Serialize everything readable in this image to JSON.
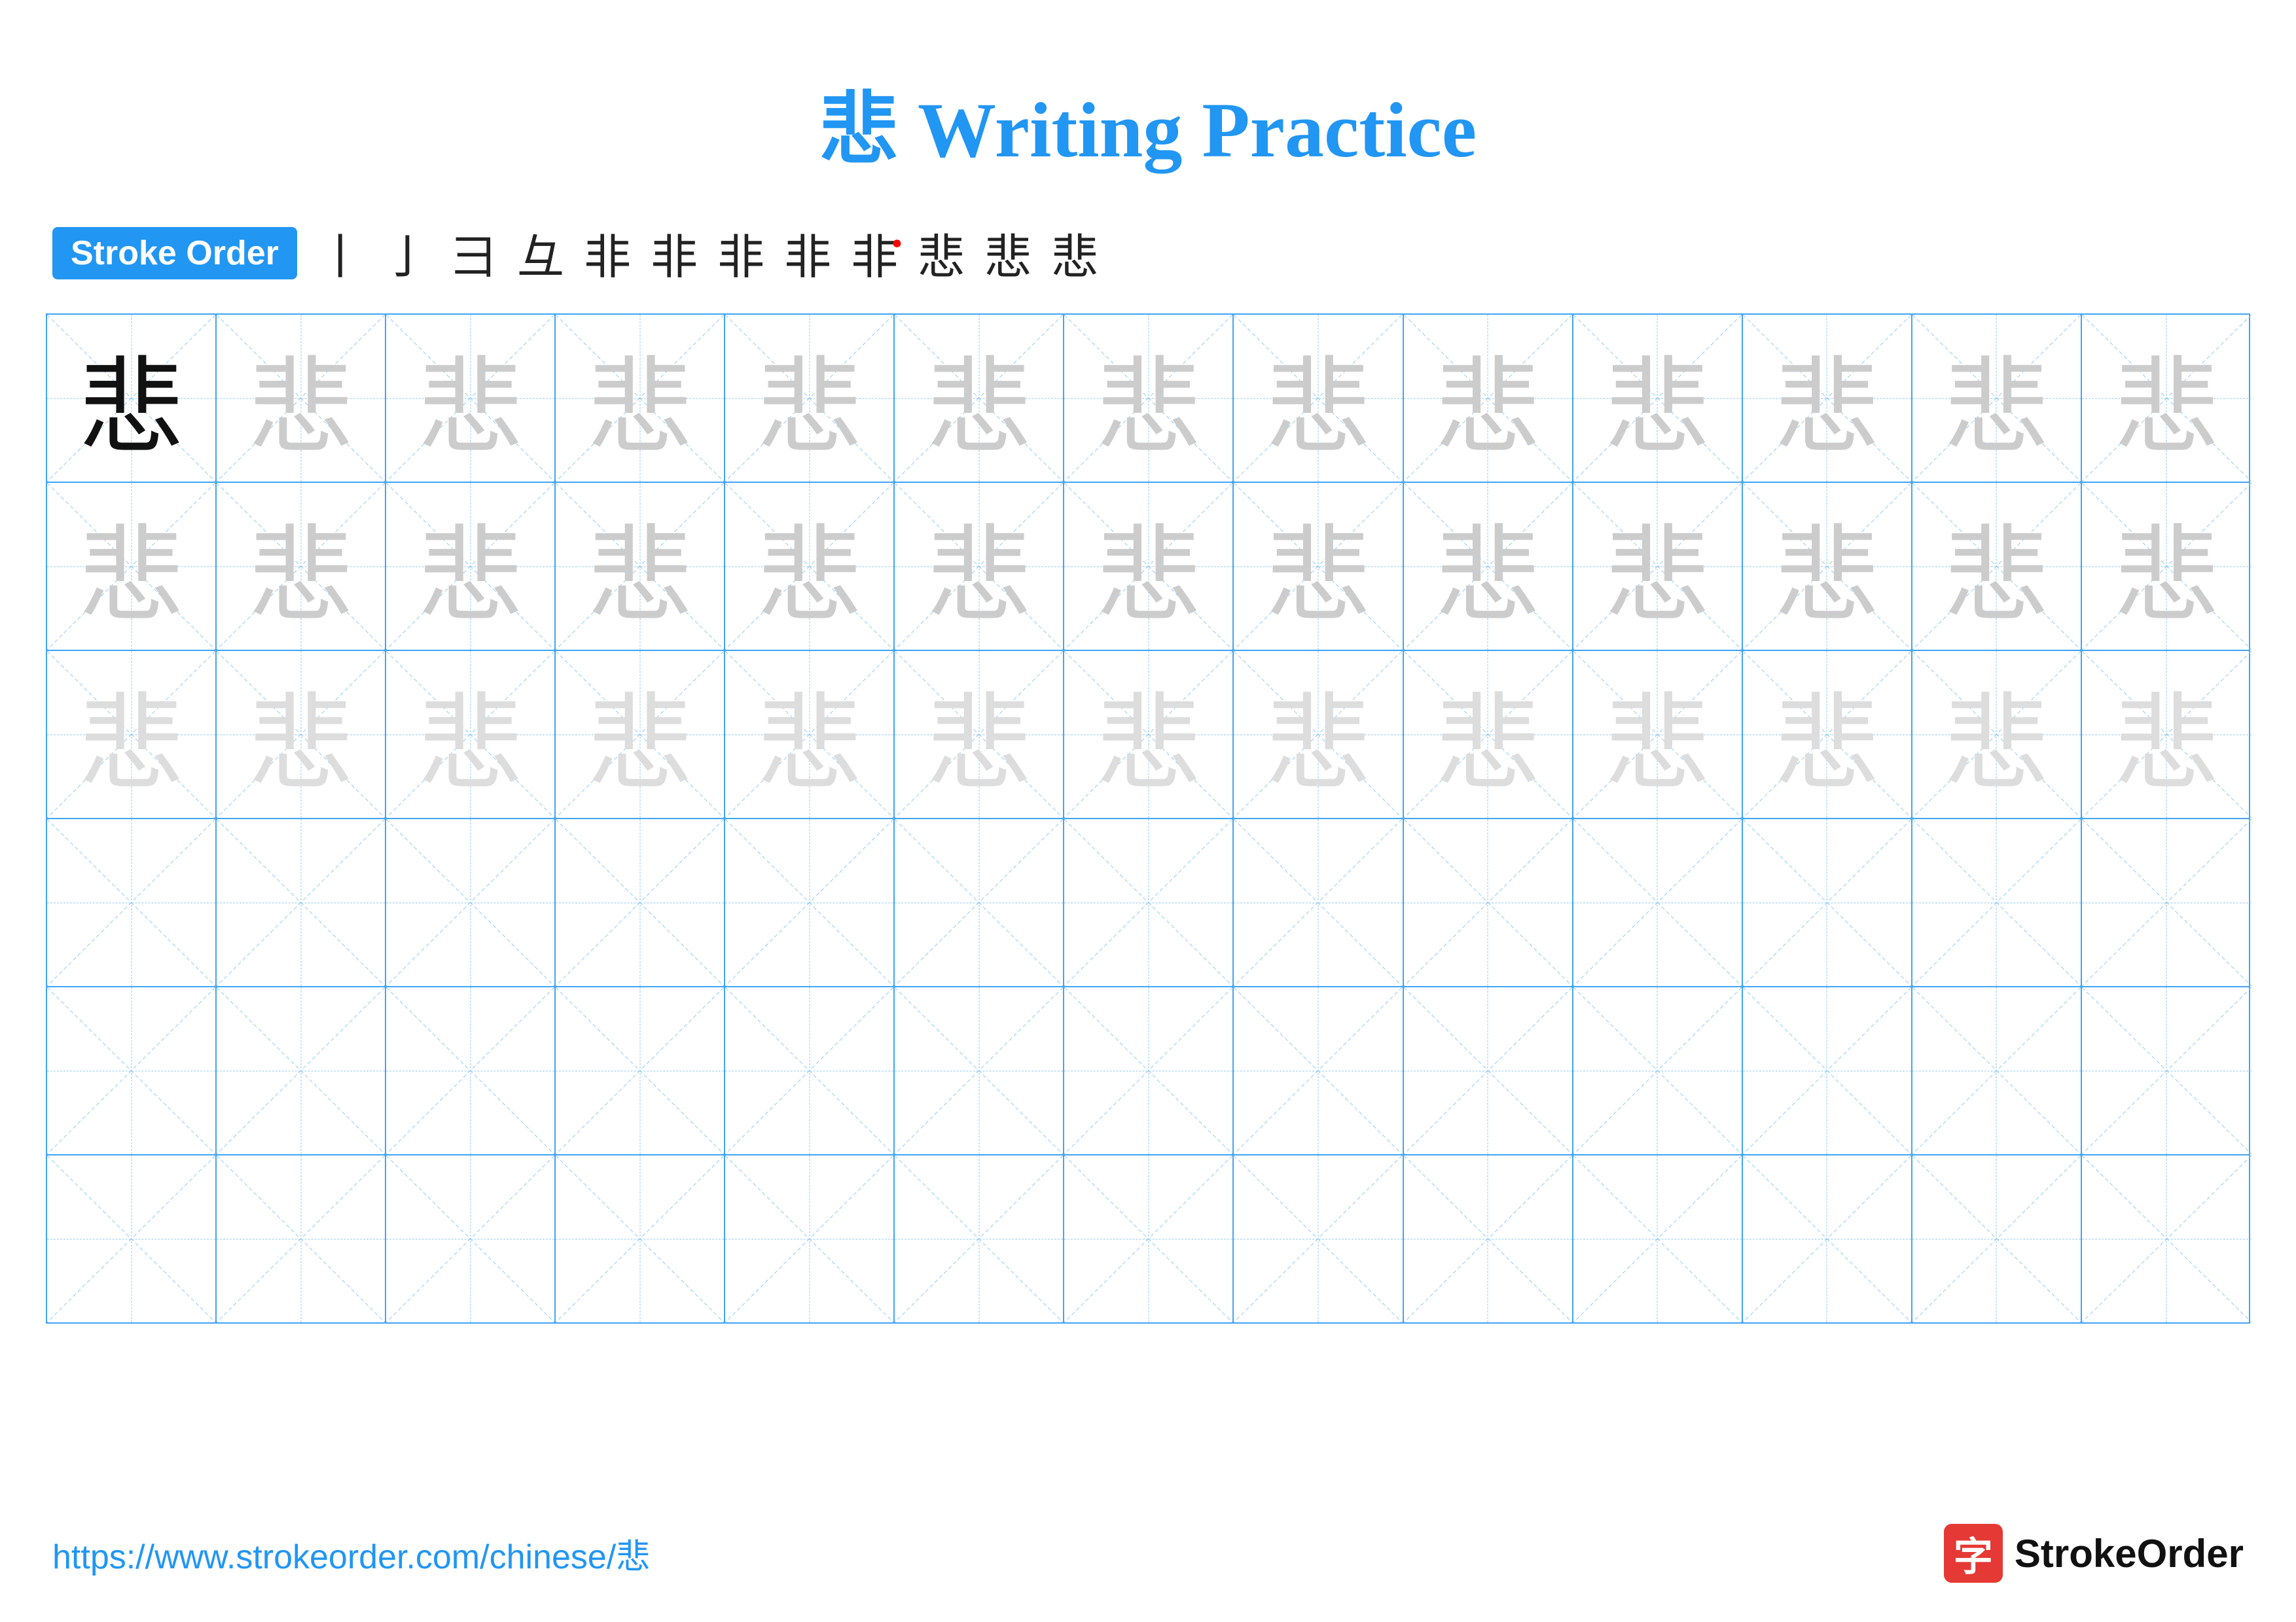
{
  "title": {
    "char": "悲",
    "text": " Writing Practice"
  },
  "stroke_order": {
    "badge_label": "Stroke Order",
    "steps": [
      "丨",
      "亅",
      "彐",
      "彑",
      "非",
      "非",
      "非",
      "非",
      "非",
      "悲",
      "悲",
      "悲"
    ]
  },
  "grid": {
    "rows": 6,
    "cols": 13,
    "char": "悲",
    "row_types": [
      "dark-then-light",
      "light",
      "lighter",
      "empty",
      "empty",
      "empty"
    ]
  },
  "footer": {
    "url": "https://www.strokeorder.com/chinese/悲",
    "logo_char": "字",
    "logo_text": "StrokeOrder"
  }
}
